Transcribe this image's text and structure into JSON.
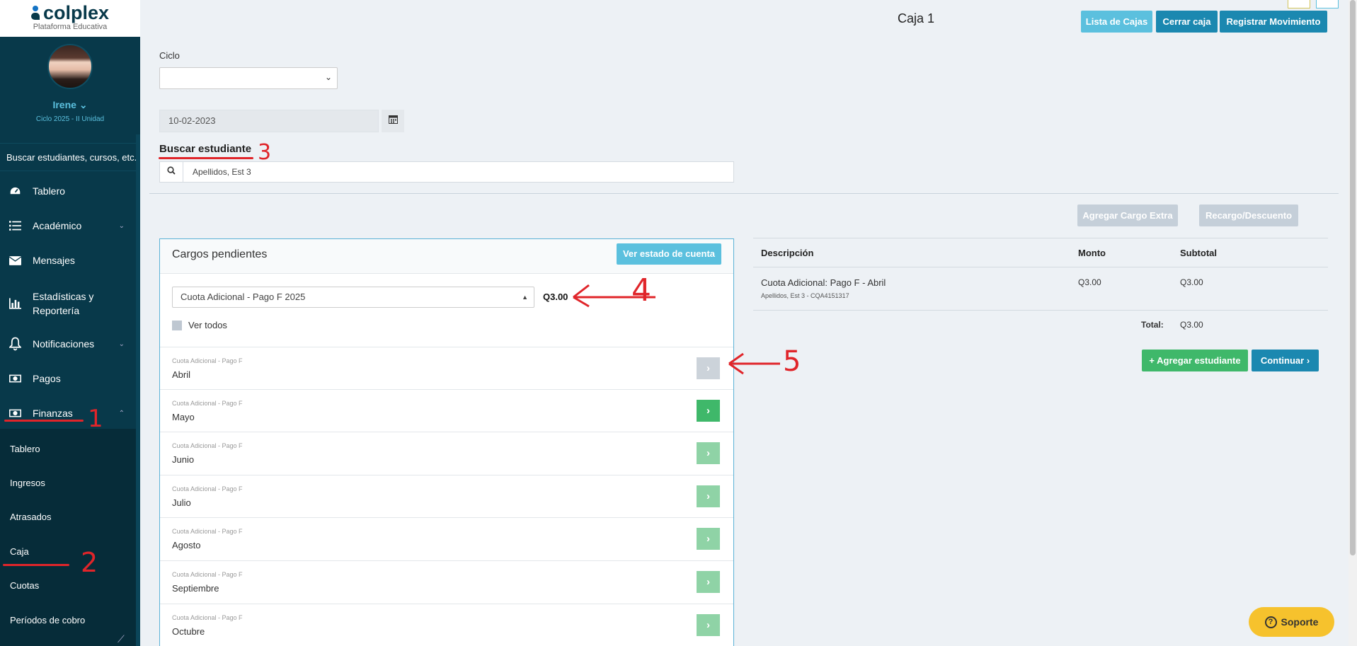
{
  "sidebar": {
    "brand": "colplex",
    "brand_sub": "Plataforma Educativa",
    "user_name": "Irene",
    "user_cycle": "Ciclo 2025 - II Unidad",
    "search_placeholder": "Buscar estudiantes, cursos, etc...",
    "items": [
      {
        "label": "Tablero",
        "icon": "dashboard-icon"
      },
      {
        "label": "Académico",
        "icon": "list-icon"
      },
      {
        "label": "Mensajes",
        "icon": "envelope-icon"
      },
      {
        "label": "Estadísticas y Reportería",
        "icon": "bar-chart-icon"
      },
      {
        "label": "Notificaciones",
        "icon": "bell-icon"
      },
      {
        "label": "Pagos",
        "icon": "money-icon"
      },
      {
        "label": "Finanzas",
        "icon": "money-icon"
      }
    ],
    "sub_items": [
      "Tablero",
      "Ingresos",
      "Atrasados",
      "Caja",
      "Cuotas",
      "Períodos de cobro"
    ]
  },
  "header": {
    "title": "Caja 1",
    "btn_lista": "Lista de Cajas",
    "btn_cerrar": "Cerrar caja",
    "btn_registrar": "Registrar Movimiento"
  },
  "form": {
    "ciclo_label": "Ciclo",
    "ciclo_value": "",
    "date_value": "10-02-2023",
    "search_title": "Buscar estudiante",
    "search_value": "Apellidos, Est 3"
  },
  "pending": {
    "title": "Cargos pendientes",
    "btn_estado": "Ver estado de cuenta",
    "fee_selected": "Cuota Adicional - Pago F 2025",
    "fee_amount": "Q3.00",
    "ver_todos": "Ver todos",
    "rows": [
      {
        "category": "Cuota Adicional - Pago F",
        "month": "Abril",
        "state": "added"
      },
      {
        "category": "Cuota Adicional - Pago F",
        "month": "Mayo",
        "state": "active"
      },
      {
        "category": "Cuota Adicional - Pago F",
        "month": "Junio",
        "state": "light"
      },
      {
        "category": "Cuota Adicional - Pago F",
        "month": "Julio",
        "state": "light"
      },
      {
        "category": "Cuota Adicional - Pago F",
        "month": "Agosto",
        "state": "light"
      },
      {
        "category": "Cuota Adicional - Pago F",
        "month": "Septiembre",
        "state": "light"
      },
      {
        "category": "Cuota Adicional - Pago F",
        "month": "Octubre",
        "state": "light"
      }
    ]
  },
  "summary": {
    "btn_cargo_extra": "Agregar Cargo Extra",
    "btn_recargo": "Recargo/Descuento",
    "col_desc": "Descripción",
    "col_monto": "Monto",
    "col_subtotal": "Subtotal",
    "item_desc": "Cuota Adicional: Pago F - Abril",
    "item_sub": "Apellidos, Est 3 - CQA4151317",
    "item_monto": "Q3.00",
    "item_subtotal": "Q3.00",
    "total_label": "Total:",
    "total_value": "Q3.00",
    "btn_agregar": "+ Agregar estudiante",
    "btn_continuar": "Continuar ›"
  },
  "annotations": [
    "1",
    "2",
    "3",
    "4",
    "5"
  ],
  "support_label": "Soporte",
  "colors": {
    "sidebar": "#08394a",
    "accent": "#5bc0de",
    "primary": "#1b88b0",
    "success": "#3fb86a",
    "annotation": "#e0252a"
  }
}
